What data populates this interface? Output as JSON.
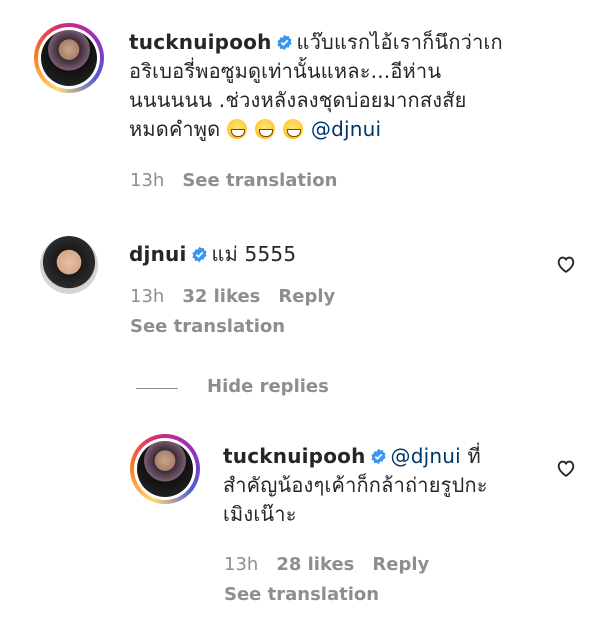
{
  "comments": [
    {
      "username": "tucknuipooh",
      "text_lines": [
        "แว๊บแรกไอ้เราก็นึกว่าเก",
        "อริเบอรี่พอซูมดูเท่านั้นแหละ...อีห่าน",
        "นนนนนน .ช่วงหลังลงชุดบ่อยมากสงสัย",
        "หมดคำพูด"
      ],
      "mention": "@djnui",
      "time": "13h",
      "see_translation": "See translation"
    },
    {
      "username": "djnui",
      "text": "แม่ 5555",
      "time": "13h",
      "likes": "32 likes",
      "reply": "Reply",
      "see_translation": "See translation"
    }
  ],
  "hide_replies": "Hide replies",
  "reply": {
    "username": "tucknuipooh",
    "mention": "@djnui",
    "text_lines": [
      "ที่",
      "สำคัญน้องๆเค้าก็กล้าถ่ายรูปกะ",
      "เมิงเน๊าะ"
    ],
    "time": "13h",
    "likes": "28 likes",
    "reply": "Reply",
    "see_translation": "See translation"
  },
  "icons": {
    "verified": "verified-badge-icon",
    "heart": "heart-outline-icon",
    "emoji": "grinning-face-icon"
  },
  "colors": {
    "verified": "#3897f0",
    "mention": "#00376b",
    "meta": "#8e8e8e",
    "text": "#262626"
  }
}
